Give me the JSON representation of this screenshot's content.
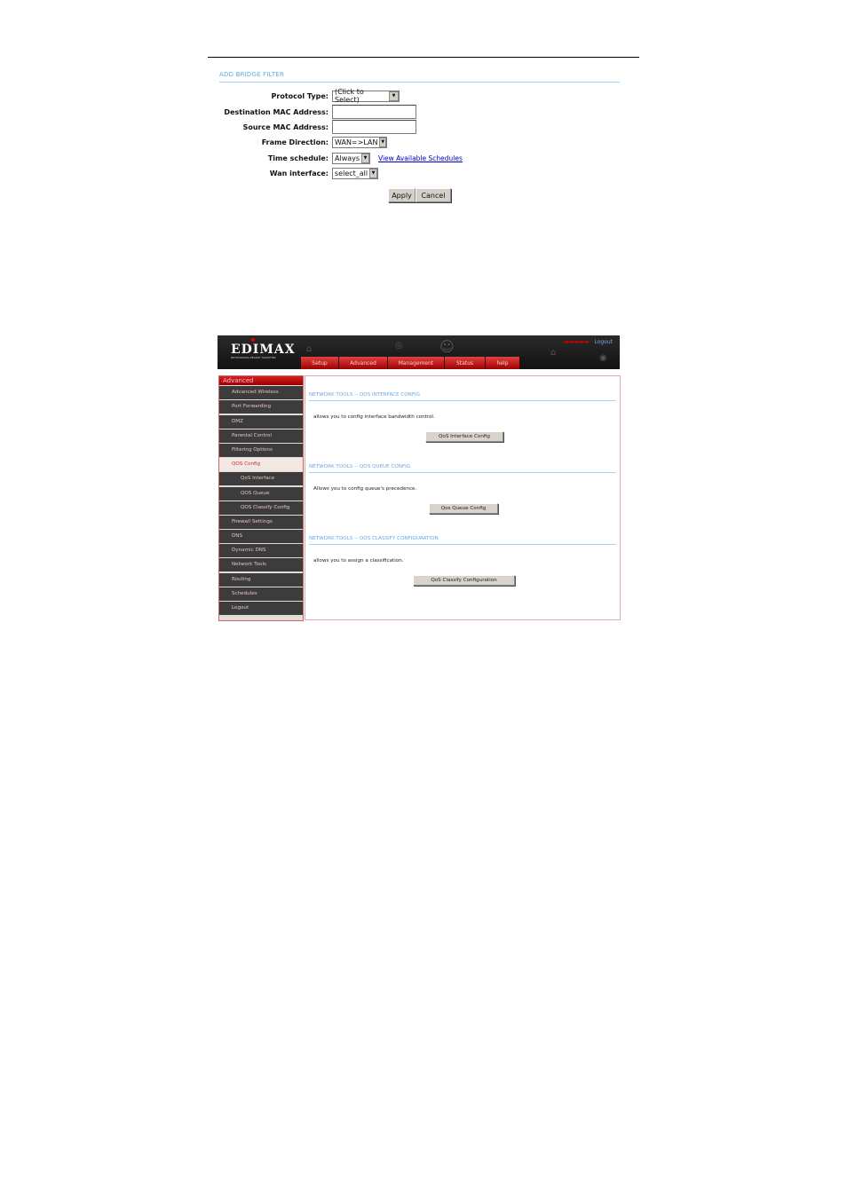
{
  "bridge_filter": {
    "title": "ADD BRIDGE FILTER",
    "fields": [
      {
        "label": "Protocol Type:",
        "type": "select",
        "value": "(Click to Select)"
      },
      {
        "label": "Destination MAC Address:",
        "type": "text",
        "value": ""
      },
      {
        "label": "Source MAC Address:",
        "type": "text",
        "value": ""
      },
      {
        "label": "Frame Direction:",
        "type": "select",
        "value": "WAN=>LAN"
      },
      {
        "label": "Time schedule:",
        "type": "select",
        "value": "Always",
        "link": "View Available Schedules"
      },
      {
        "label": "Wan interface:",
        "type": "select",
        "value": "select_all"
      }
    ],
    "apply_label": "Apply",
    "cancel_label": "Cancel"
  },
  "router": {
    "brand": "EDIMAX",
    "tagline": "NETWORKING PEOPLE TOGETHER",
    "logout_link": "Logout",
    "tabs": [
      "Setup",
      "Advanced",
      "Management",
      "Status",
      "help"
    ],
    "sidebar": {
      "heading": "Advanced",
      "items": [
        {
          "label": "Advanced Wireless",
          "sub": false,
          "active": false
        },
        {
          "label": "Port Forwarding",
          "sub": false,
          "active": false
        },
        {
          "label": "DMZ",
          "sub": false,
          "active": false
        },
        {
          "label": "Parental Control",
          "sub": false,
          "active": false
        },
        {
          "label": "Filtering Options",
          "sub": false,
          "active": false
        },
        {
          "label": "QOS Config",
          "sub": false,
          "active": true
        },
        {
          "label": "QoS Interface",
          "sub": true,
          "active": false
        },
        {
          "label": "QOS Queue",
          "sub": true,
          "active": false
        },
        {
          "label": "QOS Classify Config",
          "sub": true,
          "active": false
        },
        {
          "label": "Firewall Settings",
          "sub": false,
          "active": false
        },
        {
          "label": "DNS",
          "sub": false,
          "active": false
        },
        {
          "label": "Dynamic DNS",
          "sub": false,
          "active": false
        },
        {
          "label": "Network Tools",
          "sub": false,
          "active": false
        },
        {
          "label": "Routing",
          "sub": false,
          "active": false
        },
        {
          "label": "Schedules",
          "sub": false,
          "active": false
        },
        {
          "label": "Logout",
          "sub": false,
          "active": false
        }
      ]
    },
    "sections": [
      {
        "title": "NETWORK TOOLS -- QOS INTERFACE CONFIG",
        "desc": "allows you to config interface bandwidth control.",
        "button": "QoS Interface Config"
      },
      {
        "title": "NETWORK TOOLS -- QOS QUEUE CONFIG",
        "desc": "Allows you to config queue's precedence.",
        "button": "Qos Queue Config"
      },
      {
        "title": "NETWORK TOOLS -- QOS CLASSIFY CONFIGURATION",
        "desc": "allows you to assign a classification.",
        "button": "QoS Classify Configuration"
      }
    ]
  }
}
